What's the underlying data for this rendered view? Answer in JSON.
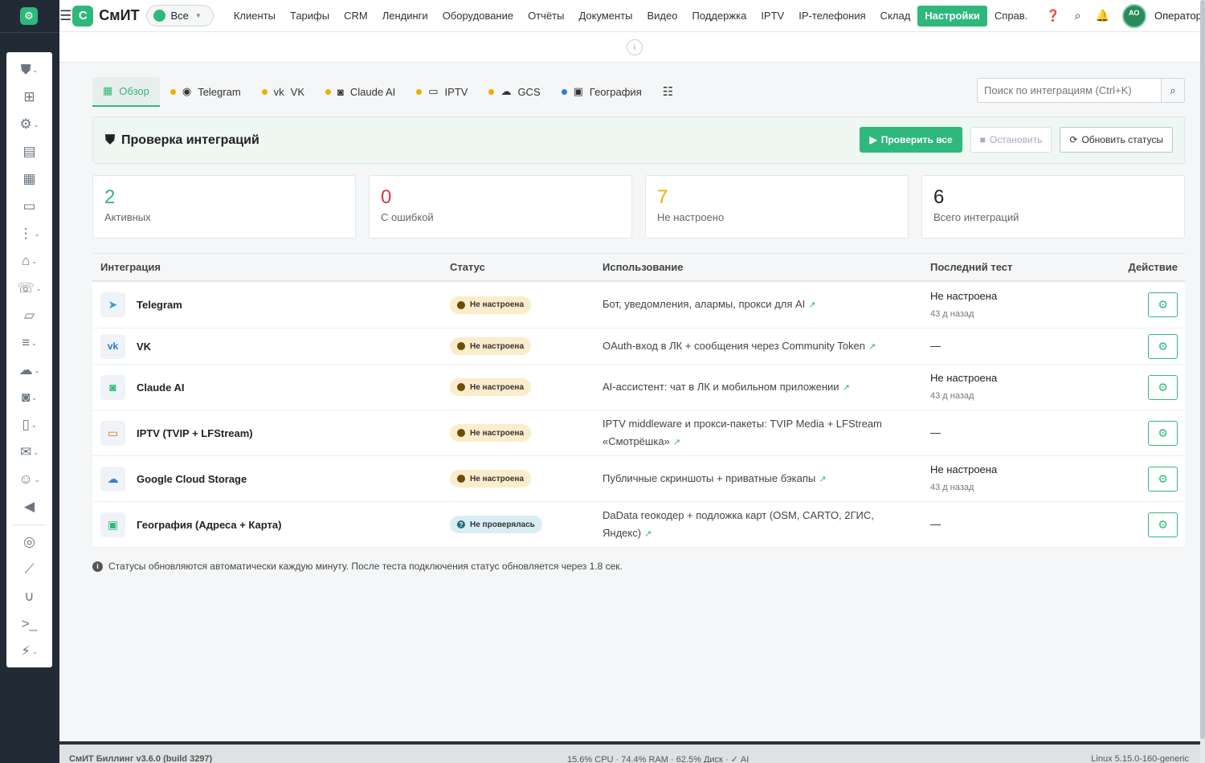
{
  "colors": {
    "accent": "#2fb87b",
    "danger": "#dc3545",
    "warning": "#f0ad00",
    "rail": "#222a35"
  },
  "rail": {
    "items": [
      {
        "icon": "shield-icon",
        "glyph": "⛊",
        "caret": true
      },
      {
        "icon": "sitemap-icon",
        "glyph": "⊞",
        "caret": false
      },
      {
        "icon": "gears-icon",
        "glyph": "⚙",
        "caret": true
      },
      {
        "icon": "print-icon",
        "glyph": "▤",
        "caret": false
      },
      {
        "icon": "cash-register-icon",
        "glyph": "▦",
        "caret": false
      },
      {
        "icon": "credit-card-icon",
        "glyph": "▭",
        "caret": false
      },
      {
        "icon": "traffic-light-icon",
        "glyph": "⋮",
        "caret": true
      },
      {
        "icon": "bank-icon",
        "glyph": "⌂",
        "caret": true
      },
      {
        "icon": "phone-volume-icon",
        "glyph": "☏",
        "caret": true
      },
      {
        "icon": "scroll-icon",
        "glyph": "▱",
        "caret": false
      },
      {
        "icon": "server-icon",
        "glyph": "≡",
        "caret": true
      },
      {
        "icon": "cloud-icon",
        "glyph": "☁",
        "caret": true
      },
      {
        "icon": "robot-icon",
        "glyph": "◙",
        "caret": true
      },
      {
        "icon": "mobile-icon",
        "glyph": "▯",
        "caret": true
      },
      {
        "icon": "envelope-icon",
        "glyph": "✉",
        "caret": true
      },
      {
        "icon": "users-cog-icon",
        "glyph": "☺",
        "caret": true
      },
      {
        "icon": "bullhorn-icon",
        "glyph": "◀",
        "caret": false
      },
      {
        "icon": "database-icon",
        "glyph": "◎",
        "caret": false
      },
      {
        "icon": "broom-icon",
        "glyph": "⟋",
        "caret": false
      },
      {
        "icon": "stethoscope-icon",
        "glyph": "∪",
        "caret": false
      },
      {
        "icon": "terminal-icon",
        "glyph": ">_",
        "caret": false
      },
      {
        "icon": "bolt-icon",
        "glyph": "⚡",
        "caret": true
      }
    ]
  },
  "topbar": {
    "brand_letter": "С",
    "brand_name": "СмИТ",
    "scope": "Все",
    "menu": [
      "Клиенты",
      "Тарифы",
      "CRM",
      "Лендинги",
      "Оборудование",
      "Отчёты",
      "Документы",
      "Видео",
      "Поддержка",
      "IPTV",
      "IP-телефония",
      "Склад",
      "Настройки",
      "Справ."
    ],
    "active_menu": "Настройки",
    "avatar_initials": "АО",
    "user_name": "Оператор"
  },
  "info_glyph": "i",
  "tabs": [
    {
      "label": "Обзор",
      "icon": "table-icon",
      "glyph": "▦",
      "dot": "",
      "active": true
    },
    {
      "label": "Telegram",
      "icon": "telegram-icon",
      "glyph": "◉",
      "dot": "#f0ad00",
      "active": false
    },
    {
      "label": "VK",
      "icon": "vk-icon",
      "glyph": "vk",
      "dot": "#f0ad00",
      "active": false
    },
    {
      "label": "Claude AI",
      "icon": "robot-icon",
      "glyph": "◙",
      "dot": "#f0ad00",
      "active": false
    },
    {
      "label": "IPTV",
      "icon": "tv-icon",
      "glyph": "▭",
      "dot": "#f0ad00",
      "active": false
    },
    {
      "label": "GCS",
      "icon": "cloud-icon",
      "glyph": "☁",
      "dot": "#f0ad00",
      "active": false
    },
    {
      "label": "География",
      "icon": "map-icon",
      "glyph": "▣",
      "dot": "#2f7fd8",
      "active": false
    }
  ],
  "search": {
    "placeholder": "Поиск по интеграциям (Ctrl+K)"
  },
  "check": {
    "title": "Проверка интеграций",
    "run_all": "Проверить все",
    "stop": "Остановить",
    "refresh": "Обновить статусы"
  },
  "stats": [
    {
      "value": "2",
      "label": "Активных",
      "color": "#2fb87b"
    },
    {
      "value": "0",
      "label": "С ошибкой",
      "color": "#dc3545"
    },
    {
      "value": "7",
      "label": "Не настроено",
      "color": "#f0ad00"
    },
    {
      "value": "6",
      "label": "Всего интеграций",
      "color": "#222222"
    }
  ],
  "table": {
    "headers": [
      "Интеграция",
      "Статус",
      "Использование",
      "Последний тест",
      "Действие"
    ],
    "rows": [
      {
        "name": "Telegram",
        "icon": "telegram-icon",
        "glyph": "➤",
        "icon_color": "#2a9fd8",
        "status": "Не настроена",
        "status_kind": "warn",
        "usage": "Бот, уведомления, алармы, прокси для AI",
        "last_test": "Не настроена",
        "last_ago": "43 д назад",
        "h": 58
      },
      {
        "name": "VK",
        "icon": "vk-icon",
        "glyph": "vk",
        "icon_color": "#2d77d0",
        "status": "Не настроена",
        "status_kind": "warn",
        "usage": "OAuth-вход в ЛК + сообщения через Community Token",
        "last_test": "—",
        "last_ago": "",
        "h": 45
      },
      {
        "name": "Claude AI",
        "icon": "robot-icon",
        "glyph": "◙",
        "icon_color": "#2fb87b",
        "status": "Не настроена",
        "status_kind": "warn",
        "usage": "AI-ассистент: чат в ЛК и мобильном приложении",
        "last_test": "Не настроена",
        "last_ago": "43 д назад",
        "h": 57
      },
      {
        "name": "IPTV (TVIP + LFStream)",
        "icon": "tv-icon",
        "glyph": "▭",
        "icon_color": "#ee6a2a",
        "status": "Не настроена",
        "status_kind": "warn",
        "usage": "IPTV middleware и прокси-пакеты: TVIP Media + LFStream «Смотрёшка»",
        "last_test": "—",
        "last_ago": "",
        "h": 57
      },
      {
        "name": "Google Cloud Storage",
        "icon": "cloud-icon",
        "glyph": "☁",
        "icon_color": "#2f7fd8",
        "status": "Не настроена",
        "status_kind": "warn",
        "usage": "Публичные скриншоты + приватные бэкапы",
        "last_test": "Не настроена",
        "last_ago": "43 д назад",
        "h": 57
      },
      {
        "name": "География (Адреса + Карта)",
        "icon": "map-icon",
        "glyph": "▣",
        "icon_color": "#2fb87b",
        "status": "Не проверялась",
        "status_kind": "info",
        "usage": "DaData геокодер + подложка карт (OSM, CARTO, 2ГИС, Яндекс)",
        "last_test": "—",
        "last_ago": "",
        "h": 57
      }
    ]
  },
  "note": "Статусы обновляются автоматически каждую минуту. После теста подключения статус обновляется через 1.8 сек.",
  "footer": {
    "left": "СмИТ Биллинг v3.6.0 (build 3297)",
    "center": "15.6% CPU · 74.4% RAM · 62.5% Диск · ✓ AI",
    "right": "Linux 5.15.0-160-generic"
  }
}
